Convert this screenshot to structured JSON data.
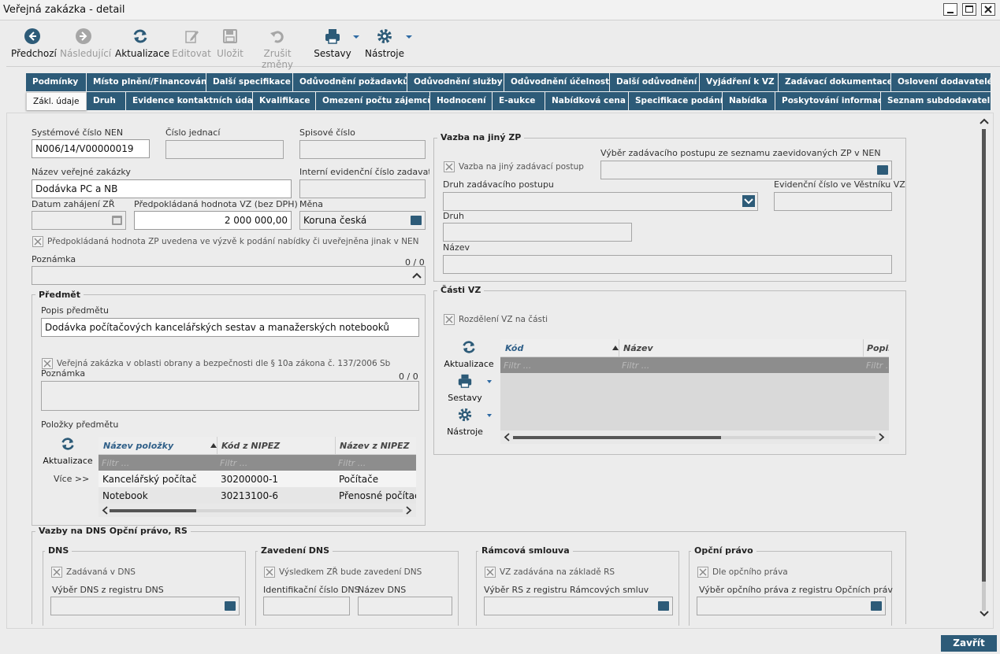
{
  "window": {
    "title": "Veřejná zakázka - detail"
  },
  "toolbar": {
    "prev": "Předchozí",
    "next": "Následující",
    "refresh": "Aktualizace",
    "edit": "Editovat",
    "save": "Uložit",
    "cancel": "Zrušit změny",
    "reports": "Sestavy",
    "tools": "Nástroje"
  },
  "tabs_row1": [
    "Podmínky",
    "Místo plnění/Financování",
    "Další specifikace",
    "Odůvodnění požadavků",
    "Odůvodnění služby",
    "Odůvodnění účelnosti",
    "Další odůvodnění",
    "Vyjádření k VZ",
    "Zadávací dokumentace",
    "Oslovení dodavatelé"
  ],
  "tabs_row2": [
    "Zákl. údaje",
    "Druh",
    "Evidence kontaktních údajů",
    "Kvalifikace",
    "Omezení počtu zájemců",
    "Hodnocení",
    "E-aukce",
    "Nabídková cena",
    "Specifikace podání",
    "Nabídka",
    "Poskytování informací",
    "Seznam subdodavatelů"
  ],
  "basic": {
    "sys_no_label": "Systémové číslo NEN",
    "sys_no": "N006/14/V00000019",
    "ref_no_label": "Číslo jednací",
    "ref_no": "",
    "file_no_label": "Spisové číslo",
    "file_no": "",
    "name_label": "Název veřejné zakázky",
    "name": "Dodávka PC a NB",
    "internal_label": "Interní evidenční číslo zadavatele",
    "internal": "",
    "start_label": "Datum zahájení ZŘ",
    "start": "",
    "value_label": "Předpokládaná hodnota VZ (bez DPH)",
    "value": "2 000 000,00",
    "currency_label": "Měna",
    "currency": "Koruna česká",
    "published_check": "Předpokládaná hodnota ZP uvedena ve výzvě k podání nabídky či uveřejněna jinak v NEN",
    "note_label": "Poznámka",
    "note_count": "0 / 0"
  },
  "subject": {
    "title": "Předmět",
    "desc_label": "Popis předmětu",
    "desc": "Dodávka počítačových kancelářských sestav a manažerských notebooků",
    "defense_check": "Veřejná zakázka v oblasti obrany a bezpečnosti dle § 10a zákona č. 137/2006 Sb",
    "note_label": "Poznámka",
    "note_count": "0 / 0",
    "items_label": "Položky předmětu",
    "refresh": "Aktualizace",
    "more": "Více >>",
    "columns": [
      "Název položky",
      "Kód z NIPEZ",
      "Název z NIPEZ"
    ],
    "filter": "Filtr ...",
    "rows": [
      [
        "Kancelářský počítač",
        "30200000-1",
        "Počítače"
      ],
      [
        "Notebook",
        "30213100-6",
        "Přenosné počítače"
      ]
    ]
  },
  "link": {
    "title": "Vazba na jiný ZP",
    "check": "Vazba na jiný zadávací postup",
    "select_label": "Výběr zadávacího postupu ze seznamu zaevidovaných ZP v NEN",
    "kind_label": "Druh zadávacího postupu",
    "journal_label": "Evidenční číslo ve Věstníku VZ",
    "type_label": "Druh",
    "name_label": "Název"
  },
  "parts": {
    "title": "Části VZ",
    "check": "Rozdělení VZ na části",
    "refresh": "Aktualizace",
    "reports": "Sestavy",
    "tools": "Nástroje",
    "columns": [
      "Kód",
      "Název",
      "Popis"
    ],
    "filter": "Filtr ..."
  },
  "dns": {
    "title": "Vazby na DNS Opční právo, RS",
    "dns_title": "DNS",
    "dns_check": "Zadávaná v DNS",
    "dns_select": "Výběr DNS z registru DNS",
    "intro_title": "Zavedení DNS",
    "intro_check": "Výsledkem ZŘ bude zavedení DNS",
    "intro_id": "Identifikační číslo DNS",
    "intro_name": "Název DNS",
    "rs_title": "Rámcová smlouva",
    "rs_check": "VZ zadávána na základě RS",
    "rs_select": "Výběr RS z registru Rámcových smluv",
    "opt_title": "Opční právo",
    "opt_check": "Dle opčního práva",
    "opt_select": "Výběr opčního práva z registru Opčních práv"
  },
  "footer": {
    "close": "Zavřít"
  }
}
